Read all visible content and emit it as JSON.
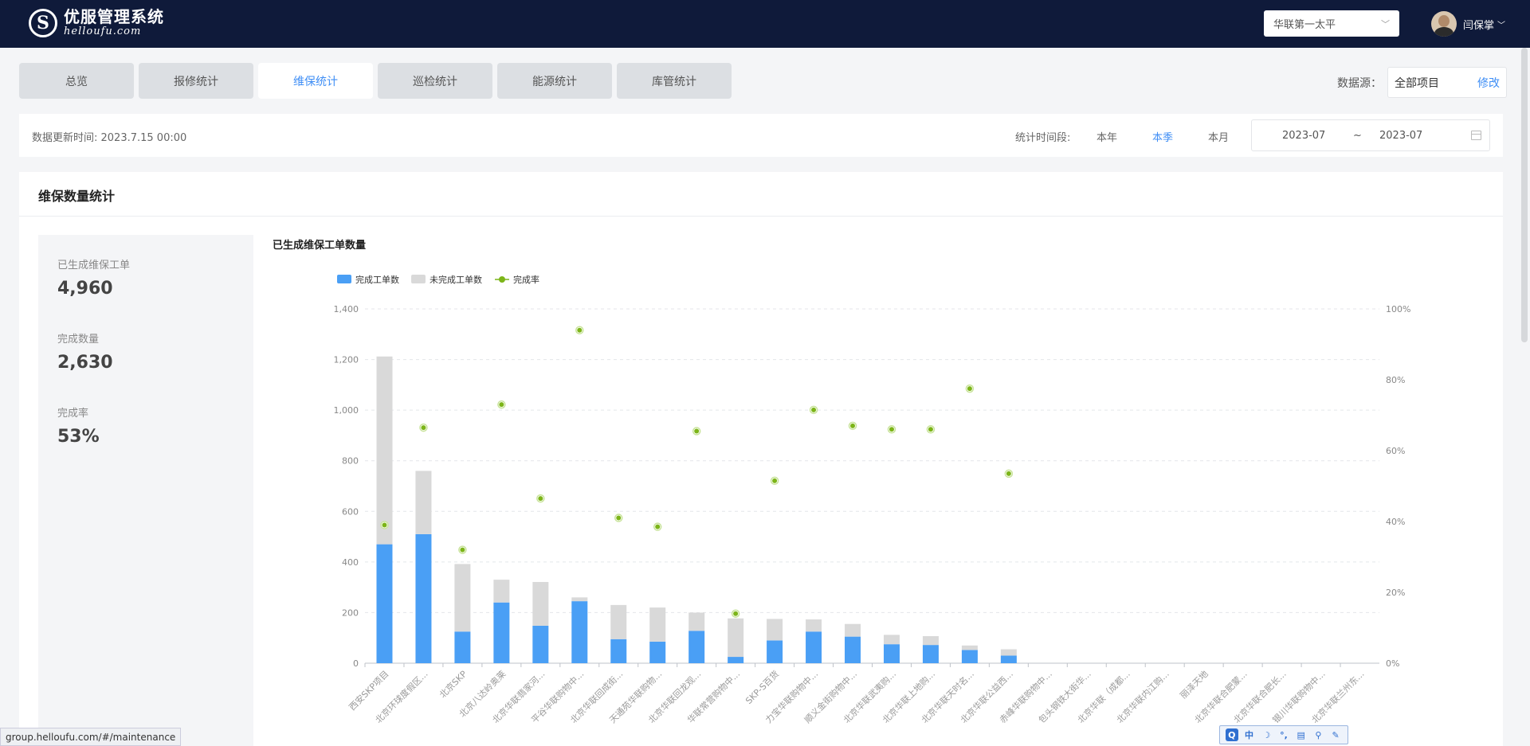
{
  "header": {
    "logo_glyph": "S",
    "logo_title": "优服管理系统",
    "logo_sub": "helloufu.com",
    "project_select": "华联第一太平",
    "user_name": "闫保掌"
  },
  "tabs": [
    {
      "label": "总览",
      "active": false
    },
    {
      "label": "报修统计",
      "active": false
    },
    {
      "label": "维保统计",
      "active": true
    },
    {
      "label": "巡检统计",
      "active": false
    },
    {
      "label": "能源统计",
      "active": false
    },
    {
      "label": "库管统计",
      "active": false
    }
  ],
  "data_source": {
    "label": "数据源：",
    "value": "全部项目",
    "edit": "修改"
  },
  "info": {
    "update_time": "数据更新时间: 2023.7.15 00:00",
    "period_label": "统计时间段:",
    "period_options": [
      {
        "label": "本年",
        "active": false
      },
      {
        "label": "本季",
        "active": true
      },
      {
        "label": "本月",
        "active": false
      }
    ],
    "date_start": "2023-07",
    "date_sep": "~",
    "date_end": "2023-07"
  },
  "card": {
    "title": "维保数量统计"
  },
  "stats": [
    {
      "label": "已生成维保工单",
      "value": "4,960"
    },
    {
      "label": "完成数量",
      "value": "2,630"
    },
    {
      "label": "完成率",
      "value": "53%"
    }
  ],
  "status_url": "group.helloufu.com/#/maintenance",
  "ime": [
    "中",
    "☽",
    "°,",
    "▤",
    "⚲",
    "✎"
  ],
  "colors": {
    "complete": "#4a9ff5",
    "incomplete": "#d9d9d9",
    "rate": "#7cb518",
    "accent": "#3f8ef5"
  },
  "chart_data": {
    "type": "bar",
    "title": "已生成维保工单数量",
    "stacked": true,
    "legend_position": "top-left",
    "grid": true,
    "categories": [
      "西安SKP项目",
      "北京环球度假区...",
      "北京SKP",
      "北京八达岭奥莱",
      "北京华联翡家河...",
      "平谷华联购物中...",
      "北京华联回成街...",
      "天通苑华联购物...",
      "北京华联回龙观...",
      "华联常营购物中...",
      "SKP-S百货",
      "力宝华联购物中...",
      "顺义金街购物中...",
      "北京华联武夷购...",
      "北京华联上地购...",
      "北京华联天时名...",
      "北京华联公益西...",
      "赤峰华联购物中...",
      "包头钢铁大街华...",
      "北京华联（成都...",
      "北京华联内江购...",
      "丽泽天地",
      "北京华联合肥蒙...",
      "北京华联合肥长...",
      "银川华联购物中...",
      "北京华联兰州东..."
    ],
    "series": [
      {
        "name": "完成工单数",
        "axis": "left",
        "values": [
          470,
          510,
          125,
          240,
          148,
          245,
          95,
          85,
          128,
          25,
          90,
          125,
          105,
          75,
          72,
          52,
          30,
          0,
          0,
          0,
          0,
          0,
          0,
          0,
          0,
          0
        ]
      },
      {
        "name": "未完成工单数",
        "axis": "left",
        "values": [
          742,
          250,
          267,
          90,
          173,
          15,
          135,
          135,
          72,
          152,
          85,
          48,
          50,
          37,
          35,
          18,
          25,
          0,
          0,
          0,
          0,
          0,
          0,
          0,
          0,
          0
        ]
      },
      {
        "name": "完成率",
        "axis": "right",
        "unit": "%",
        "values": [
          39,
          66.5,
          32,
          73,
          46.5,
          94,
          41,
          38.5,
          65.5,
          14,
          51.5,
          71.5,
          67,
          66,
          66,
          77.5,
          53.5,
          null,
          null,
          null,
          null,
          null,
          null,
          null,
          null,
          null
        ]
      }
    ],
    "y_left": {
      "min": 0,
      "max": 1400,
      "ticks": [
        "0",
        "200",
        "400",
        "600",
        "800",
        "1,000",
        "1,200",
        "1,400"
      ],
      "tick_values": [
        0,
        200,
        400,
        600,
        800,
        1000,
        1200,
        1400
      ]
    },
    "y_right": {
      "min": 0,
      "max": 100,
      "ticks": [
        "0%",
        "20%",
        "40%",
        "60%",
        "80%",
        "100%"
      ],
      "tick_values": [
        0,
        20,
        40,
        60,
        80,
        100
      ]
    }
  }
}
